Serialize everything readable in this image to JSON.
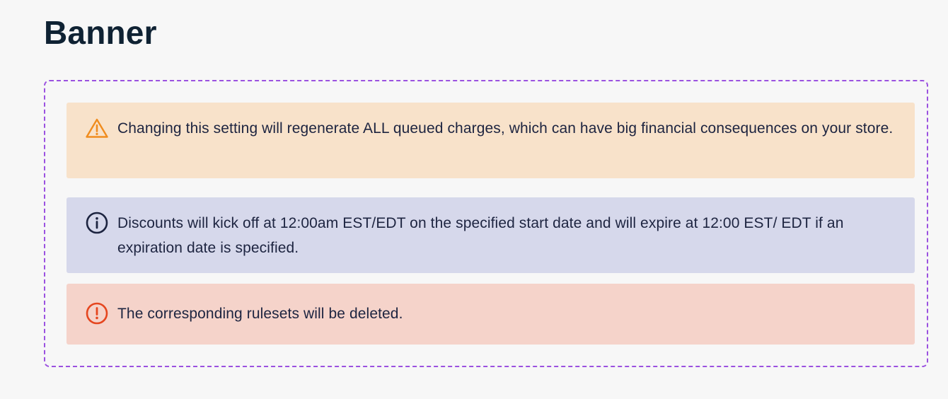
{
  "page": {
    "title": "Banner"
  },
  "banners": [
    {
      "variant": "warning",
      "icon": "warning-triangle-icon",
      "text": "Changing this setting will regenerate ALL queued charges, which can have big financial consequences on your store.",
      "color": "#f8e2ca",
      "icon_color": "#f08c1e"
    },
    {
      "variant": "info",
      "icon": "info-circle-icon",
      "text": "Discounts will kick off at 12:00am EST/EDT on the specified start date and will expire at 12:00 EST/ EDT if an expiration date is specified.",
      "color": "#d6d8eb",
      "icon_color": "#1d2440"
    },
    {
      "variant": "error",
      "icon": "exclamation-circle-icon",
      "text": "The corresponding rulesets will be deleted.",
      "color": "#f5d3ca",
      "icon_color": "#e5461f"
    }
  ],
  "frame": {
    "border_color": "#9b51e0"
  }
}
